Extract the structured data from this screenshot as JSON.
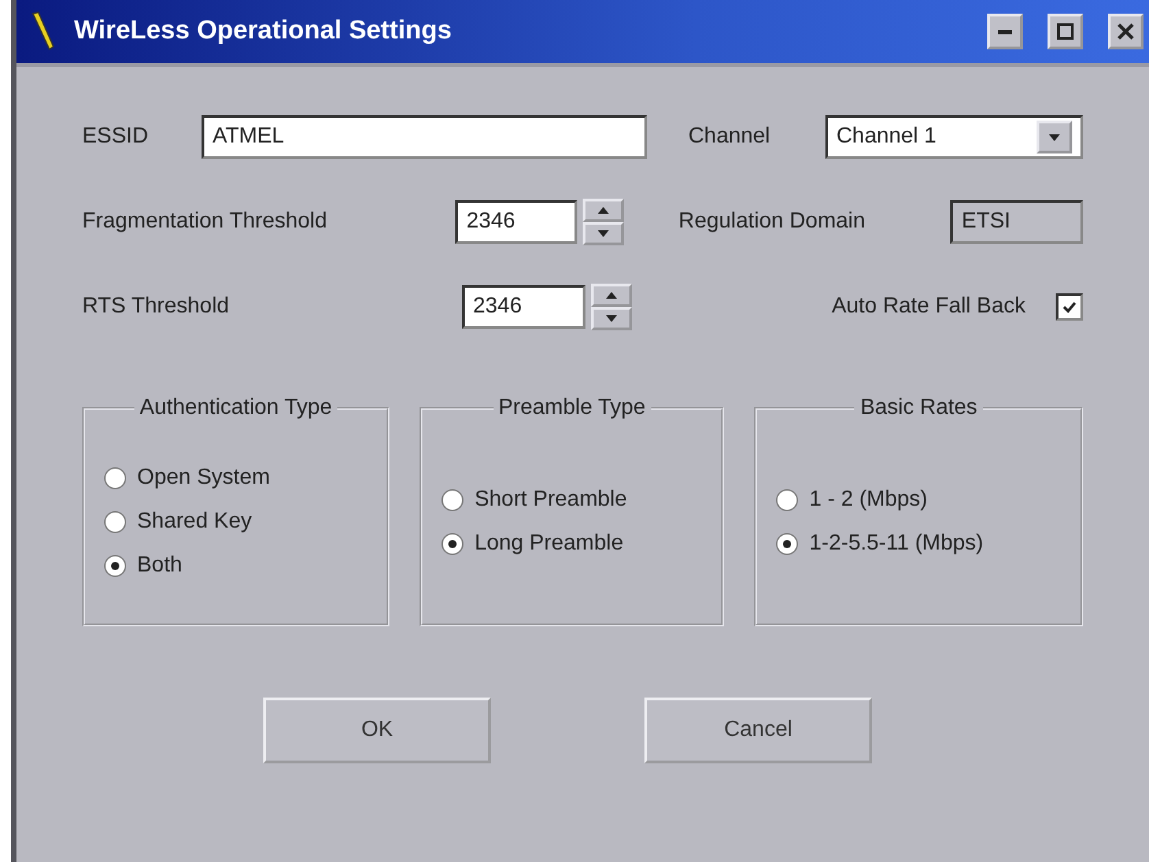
{
  "window": {
    "title": "WireLess Operational Settings"
  },
  "essid": {
    "label": "ESSID",
    "value": "ATMEL"
  },
  "channel": {
    "label": "Channel",
    "value": "Channel 1"
  },
  "fragmentation": {
    "label": "Fragmentation Threshold",
    "value": "2346"
  },
  "regulation": {
    "label": "Regulation Domain",
    "value": "ETSI"
  },
  "rts": {
    "label": "RTS Threshold",
    "value": "2346"
  },
  "auto_rate": {
    "label": "Auto Rate Fall Back",
    "checked": true
  },
  "groups": [
    {
      "title": "Authentication Type",
      "options": [
        {
          "label": "Open System",
          "selected": false
        },
        {
          "label": "Shared Key",
          "selected": false
        },
        {
          "label": "Both",
          "selected": true
        }
      ]
    },
    {
      "title": "Preamble Type",
      "options": [
        {
          "label": "Short Preamble",
          "selected": false
        },
        {
          "label": "Long Preamble",
          "selected": true
        }
      ]
    },
    {
      "title": "Basic Rates",
      "options": [
        {
          "label": "1 - 2 (Mbps)",
          "selected": false
        },
        {
          "label": "1-2-5.5-11 (Mbps)",
          "selected": true
        }
      ]
    }
  ],
  "buttons": [
    "OK",
    "Cancel"
  ]
}
